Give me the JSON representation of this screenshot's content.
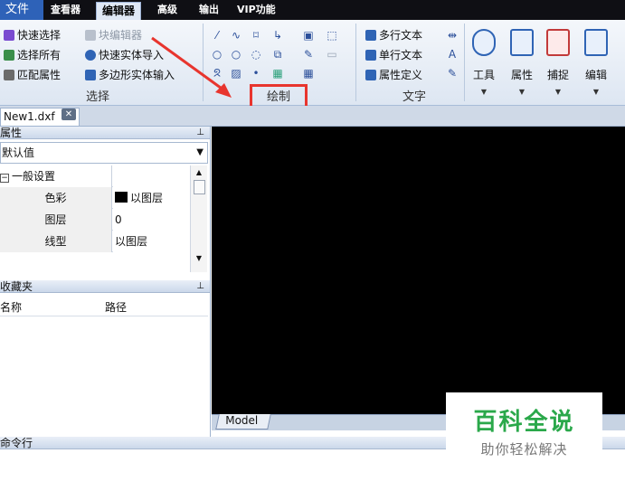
{
  "menu": {
    "file": "文件",
    "viewer": "查看器",
    "editor": "编辑器",
    "advanced": "高级",
    "output": "输出",
    "vip": "VIP功能"
  },
  "ribbon": {
    "select_group": {
      "label": "选择",
      "quick_select": "快速选择",
      "block_editor": "块编辑器",
      "select_all": "选择所有",
      "quick_entity_import": "快速实体导入",
      "match_props": "匹配属性",
      "polygon_entity_input": "多边形实体输入"
    },
    "draw_group": {
      "label": "绘制"
    },
    "text_group": {
      "label": "文字",
      "mtext": "多行文本",
      "stext": "单行文本",
      "attr_def": "属性定义"
    },
    "big_buttons": {
      "tools": "工具",
      "properties": "属性",
      "snap": "捕捉",
      "edit": "编辑"
    }
  },
  "document": {
    "tab": "New1.dxf",
    "close": "✕"
  },
  "properties_panel": {
    "title": "属性",
    "pin": "⊥",
    "default_value": "默认值",
    "section": "一般设置",
    "rows": [
      {
        "name": "色彩",
        "value": "以图层"
      },
      {
        "name": "图层",
        "value": "0"
      },
      {
        "name": "线型",
        "value": "以图层"
      }
    ]
  },
  "favorites_panel": {
    "title": "收藏夹",
    "pin": "⊥",
    "col_name": "名称",
    "col_path": "路径"
  },
  "canvas": {
    "model_tab": "Model"
  },
  "command_line": {
    "title": "命令行"
  },
  "watermark": {
    "title": "百科全说",
    "subtitle": "助你轻松解决"
  }
}
